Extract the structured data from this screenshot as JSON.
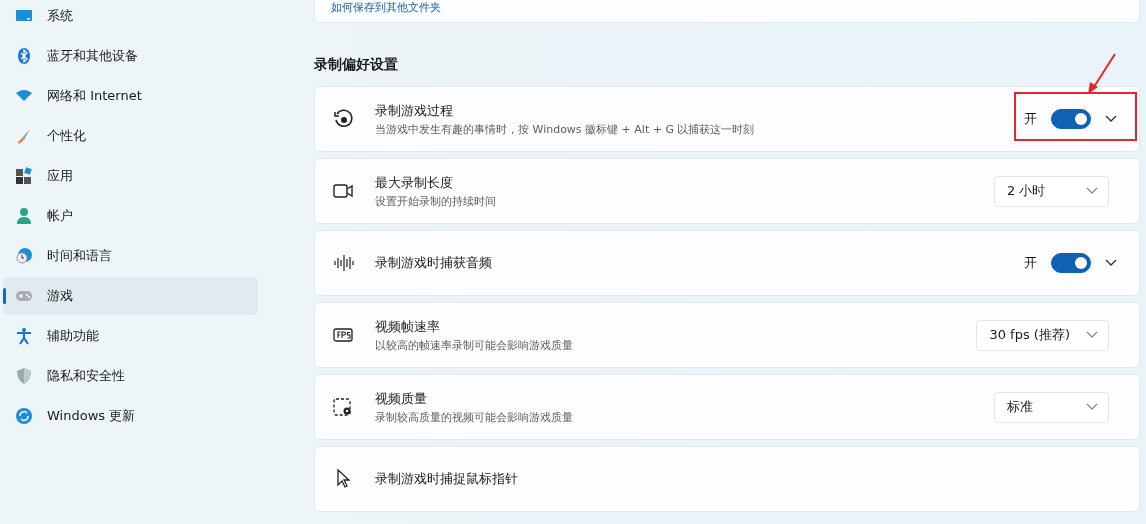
{
  "sidebar": {
    "items": [
      {
        "label": "系统",
        "selected": false
      },
      {
        "label": "蓝牙和其他设备",
        "selected": false
      },
      {
        "label": "网络和 Internet",
        "selected": false
      },
      {
        "label": "个性化",
        "selected": false
      },
      {
        "label": "应用",
        "selected": false
      },
      {
        "label": "帐户",
        "selected": false
      },
      {
        "label": "时间和语言",
        "selected": false
      },
      {
        "label": "游戏",
        "selected": true
      },
      {
        "label": "辅助功能",
        "selected": false
      },
      {
        "label": "隐私和安全性",
        "selected": false
      },
      {
        "label": "Windows 更新",
        "selected": false
      }
    ]
  },
  "top_link": "如何保存到其他文件夹",
  "section_title": "录制偏好设置",
  "settings": [
    {
      "kind": "toggle",
      "title": "录制游戏过程",
      "description": "当游戏中发生有趣的事情时，按 Windows 徽标键 + Alt + G 以捕获这一时刻",
      "state_label": "开",
      "on": true,
      "highlighted": true
    },
    {
      "kind": "dropdown",
      "title": "最大录制长度",
      "description": "设置开始录制的持续时间",
      "value": "2 小时"
    },
    {
      "kind": "toggle",
      "title": "录制游戏时捕获音频",
      "state_label": "开",
      "on": true
    },
    {
      "kind": "dropdown",
      "title": "视频帧速率",
      "description": "以较高的帧速率录制可能会影响游戏质量",
      "value": "30 fps (推荐)"
    },
    {
      "kind": "dropdown",
      "title": "视频质量",
      "description": "录制较高质量的视频可能会影响游戏质量",
      "value": "标准"
    },
    {
      "kind": "plain",
      "title": "录制游戏时捕捉鼠标指针"
    }
  ]
}
